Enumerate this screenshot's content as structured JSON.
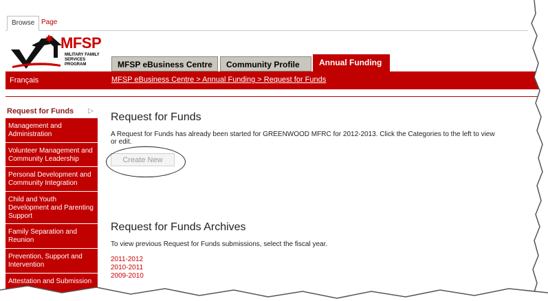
{
  "ribbon": {
    "tabs": [
      "Browse",
      "Page"
    ]
  },
  "logo": {
    "text": "MFSP",
    "program_line1": "MILITARY FAMILY",
    "program_line2": "SERVICES PROGRAM"
  },
  "nav": {
    "tabs": [
      "MFSP eBusiness Centre",
      "Community Profile",
      "Annual Funding"
    ],
    "active": "Annual Funding"
  },
  "bar": {
    "language_link": "Français",
    "breadcrumb": "MFSP eBusiness Centre > Annual Funding > Request for Funds"
  },
  "sidebar": {
    "header": "Request for Funds",
    "items": [
      "Management and Administration",
      "Volunteer Management and Community Leadership",
      "Personal Development and Community Integration",
      "Child and Youth Development and Parenting Support",
      "Family Separation and Reunion",
      "Prevention, Support and Intervention",
      "Attestation and Submission"
    ]
  },
  "main": {
    "title": "Request for Funds",
    "message": "A Request for Funds has already been started for GREENWOOD MFRC for 2012-2013. Click the Categories to the left to view or edit.",
    "create_button": "Create New",
    "archives_title": "Request for Funds Archives",
    "archives_message": "To view previous Request for Funds submissions, select the fiscal year.",
    "years": [
      "2011-2012",
      "2010-2011",
      "2009-2010"
    ]
  },
  "colors": {
    "brand_red": "#c10000",
    "tab_grey": "#c9c6bd"
  }
}
